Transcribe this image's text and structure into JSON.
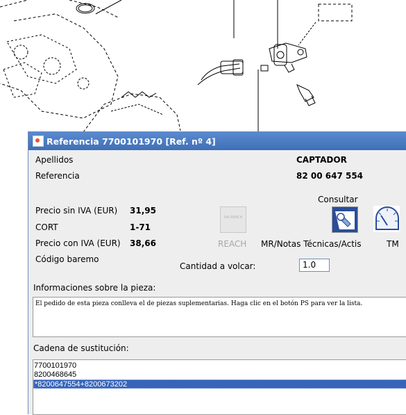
{
  "dialog": {
    "title": "Referencia 7700101970 [Ref. nº 4]"
  },
  "fields": {
    "apellidos_label": "Apellidos",
    "apellidos_value": "CAPTADOR",
    "referencia_label": "Referencia",
    "referencia_value": "82 00 647 554",
    "precio_sin_iva_label": "Precio sin IVA (EUR)",
    "precio_sin_iva_value": "31,95",
    "cort_label": "CORT",
    "cort_value": "1-71",
    "precio_con_iva_label": "Precio con IVA (EUR)",
    "precio_con_iva_value": "38,66",
    "codigo_baremo_label": "Código baremo"
  },
  "consultar": {
    "label": "Consultar",
    "buttons": [
      {
        "label": "REACH",
        "icon": "reach-icon",
        "enabled": false,
        "icon_text": "IVA REACH"
      },
      {
        "label": "MR/Notas Técnicas/Actis",
        "icon": "wrench-icon",
        "enabled": true
      },
      {
        "label": "TM",
        "icon": "gauge-icon",
        "enabled": true
      }
    ]
  },
  "quantity": {
    "label": "Cantidad a volcar:",
    "value": "1.0"
  },
  "info": {
    "label": "Informaciones sobre la pieza:",
    "text": "El pedido de esta pieza conlleva el de piezas suplementarias. Haga clic en el botón PS para ver la lista."
  },
  "chain": {
    "label": "Cadena de sustitución:",
    "items": [
      "7700101970",
      "8200468645",
      "*8200647554+8200673202"
    ],
    "selected_index": 2
  },
  "colors": {
    "titlebar": "#3f6fb6",
    "selection": "#3864b8",
    "dialog_bg": "#eeeeee"
  }
}
